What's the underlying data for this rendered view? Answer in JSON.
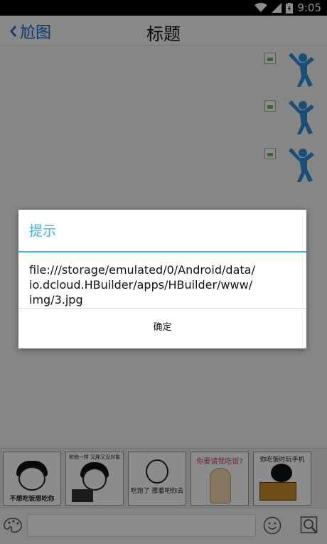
{
  "status": {
    "time": "9:05"
  },
  "nav": {
    "back_label": "尬图",
    "title": "标题"
  },
  "messages": [
    {
      "avatar": "person-icon"
    },
    {
      "avatar": "person-icon"
    },
    {
      "avatar": "person-icon"
    }
  ],
  "stickers": [
    {
      "caption": "不想吃饭想吃你"
    },
    {
      "caption": "和他一样 又胖又没对象"
    },
    {
      "caption": "吃饱了 撑着吧你去"
    },
    {
      "caption": "你要请我吃饭?"
    },
    {
      "caption": "你吃饭时玩手机"
    }
  ],
  "dialog": {
    "title": "提示",
    "message": "file:///storage/emulated/0/Android/data/\nio.dcloud.HBuilder/apps/HBuilder/www/\nimg/3.jpg",
    "confirm_label": "确定"
  },
  "colors": {
    "accent": "#33b5e5",
    "link": "#0a6cd1",
    "avatar": "#2f8fd8"
  }
}
